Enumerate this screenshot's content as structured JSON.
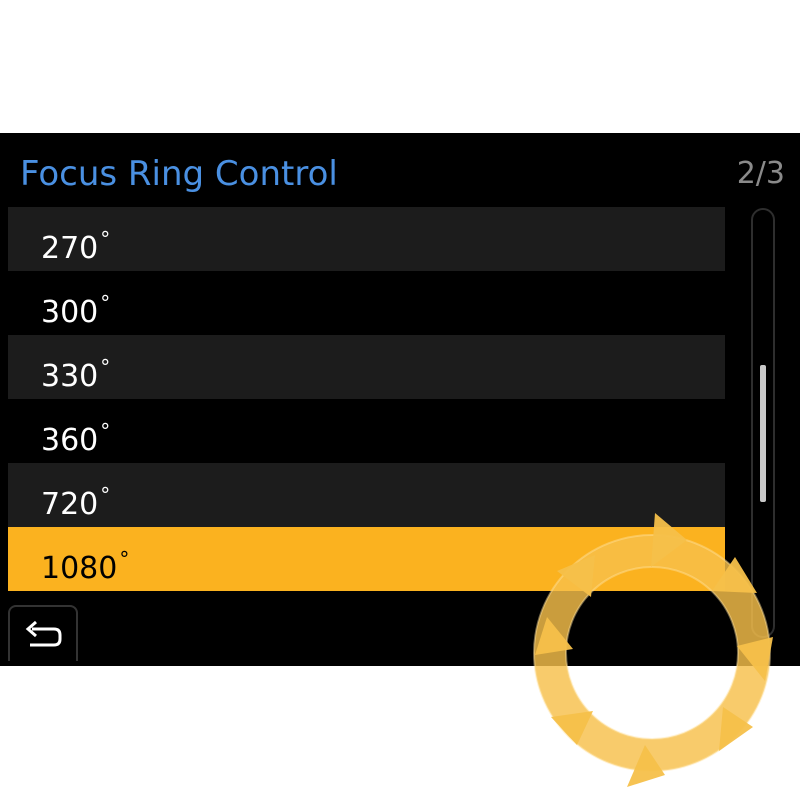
{
  "header": {
    "title": "Focus Ring Control",
    "page": "2/3"
  },
  "menu": {
    "items": [
      {
        "label": "270",
        "unit": "°"
      },
      {
        "label": "300",
        "unit": "°"
      },
      {
        "label": "330",
        "unit": "°"
      },
      {
        "label": "360",
        "unit": "°"
      },
      {
        "label": "720",
        "unit": "°"
      },
      {
        "label": "1080",
        "unit": "°"
      }
    ],
    "selected_index": 5
  },
  "icons": {
    "back": "return-arrow-icon",
    "overlay": "rotate-dial-icon"
  },
  "colors": {
    "accent_title": "#4a90e2",
    "selected": "#fbb21f",
    "dial": "#f6c04a"
  }
}
